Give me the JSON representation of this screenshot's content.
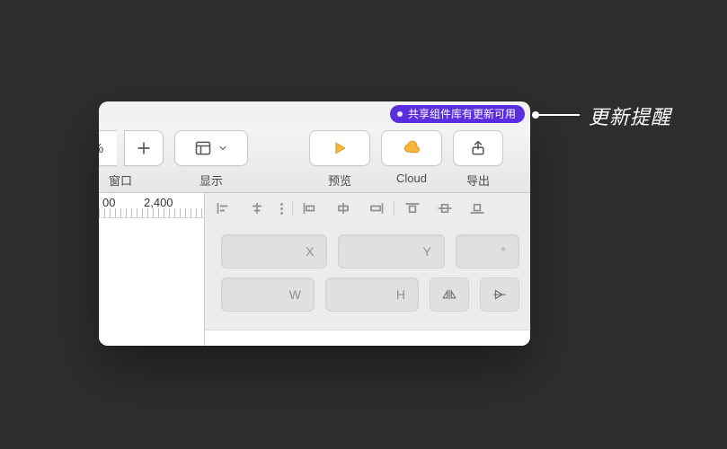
{
  "notification": {
    "text": "共享组件库有更新可用"
  },
  "callout": {
    "label": "更新提醒"
  },
  "toolbar": {
    "zoom_suffix": "%",
    "window_label": "窗口",
    "view_label": "显示",
    "preview_label": "预览",
    "cloud_label": "Cloud",
    "export_label": "导出"
  },
  "ruler": {
    "tick_a": "00",
    "tick_b": "2,400"
  },
  "inspector": {
    "x_label": "X",
    "y_label": "Y",
    "deg_label": "°",
    "w_label": "W",
    "h_label": "H"
  }
}
